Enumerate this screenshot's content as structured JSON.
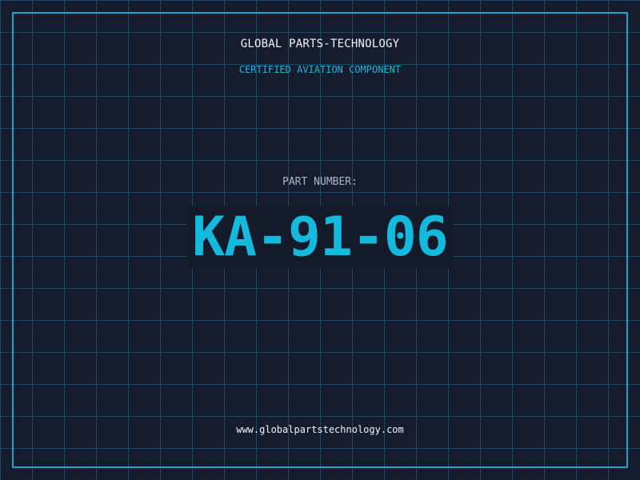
{
  "header": {
    "company": "GLOBAL PARTS-TECHNOLOGY",
    "tagline": "CERTIFIED AVIATION COMPONENT"
  },
  "part": {
    "label": "PART NUMBER:",
    "number": "KA-91-06"
  },
  "footer": {
    "url": "www.globalpartstechnology.com"
  },
  "colors": {
    "background": "#141c2e",
    "grid": "#226e8c",
    "accent": "#1fa3c6",
    "code": "#14b9de",
    "text": "#f2f4f7",
    "label": "#a9b6c8"
  }
}
